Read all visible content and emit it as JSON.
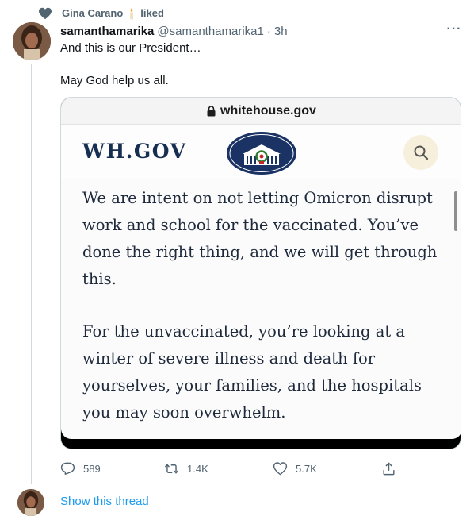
{
  "social_context": {
    "user": "Gina Carano",
    "action": "liked",
    "emoji": "candle-icon"
  },
  "tweet": {
    "display_name": "samanthamarika",
    "handle": "@samanthamarika1",
    "separator": "·",
    "time": "3h",
    "more": "···",
    "text_line1": "And this is our President…",
    "text_line2": "May God help us all."
  },
  "media": {
    "url": "whitehouse.gov",
    "site_logo": "WH.GOV",
    "paragraph1": "We are intent on not letting Omicron disrupt work and school for the vaccinated.  You’ve done the right thing, and we will get through this.",
    "paragraph2": "For the unvaccinated, you’re looking at a winter of severe illness and death for yourselves, your families, and the hospitals you may soon overwhelm."
  },
  "actions": {
    "replies": "589",
    "retweets": "1.4K",
    "likes": "5.7K"
  },
  "thread": {
    "show_thread": "Show this thread"
  },
  "colors": {
    "accent": "#1d9bf0",
    "secondary_text": "#536471",
    "primary_text": "#0f1419",
    "wh_navy": "#162e51"
  }
}
